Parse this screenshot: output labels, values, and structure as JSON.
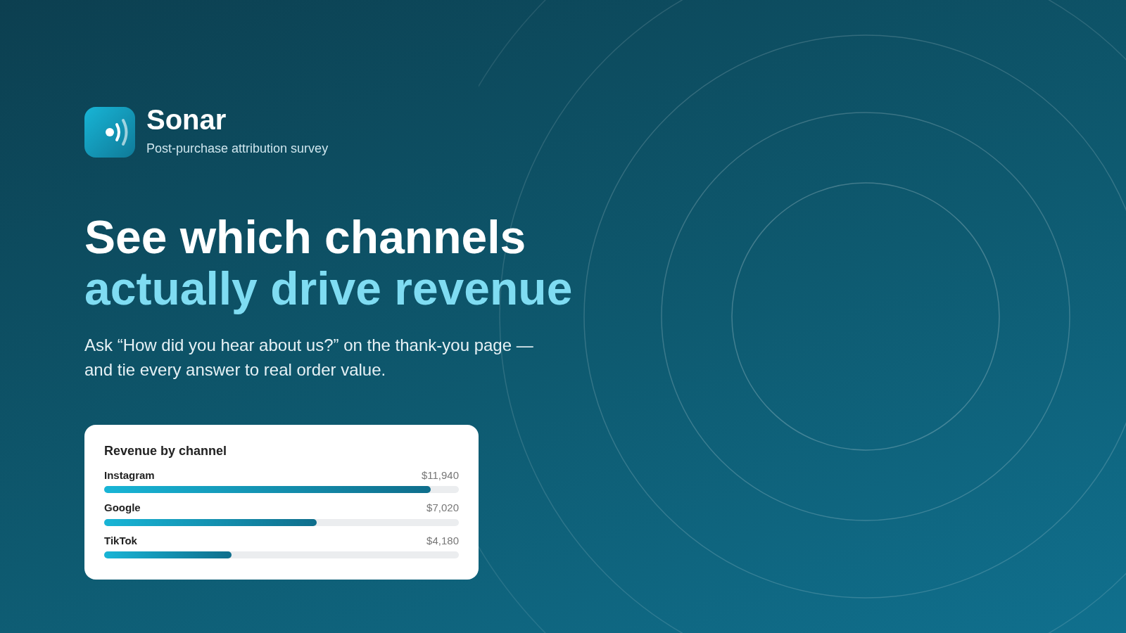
{
  "brand": {
    "name": "Sonar",
    "tagline": "Post-purchase attribution survey"
  },
  "headline": {
    "line_1": "See which channels",
    "line_2": "actually drive revenue"
  },
  "description": "Ask “How did you hear about us?” on the thank-you page — and tie every answer to real order value.",
  "revenue_card": {
    "title": "Revenue by channel",
    "channels": [
      {
        "name": "Instagram",
        "amount": "$11,940",
        "level": 0.92
      },
      {
        "name": "Google",
        "amount": "$7,020",
        "level": 0.6
      },
      {
        "name": "TikTok",
        "amount": "$4,180",
        "level": 0.36
      }
    ]
  }
}
